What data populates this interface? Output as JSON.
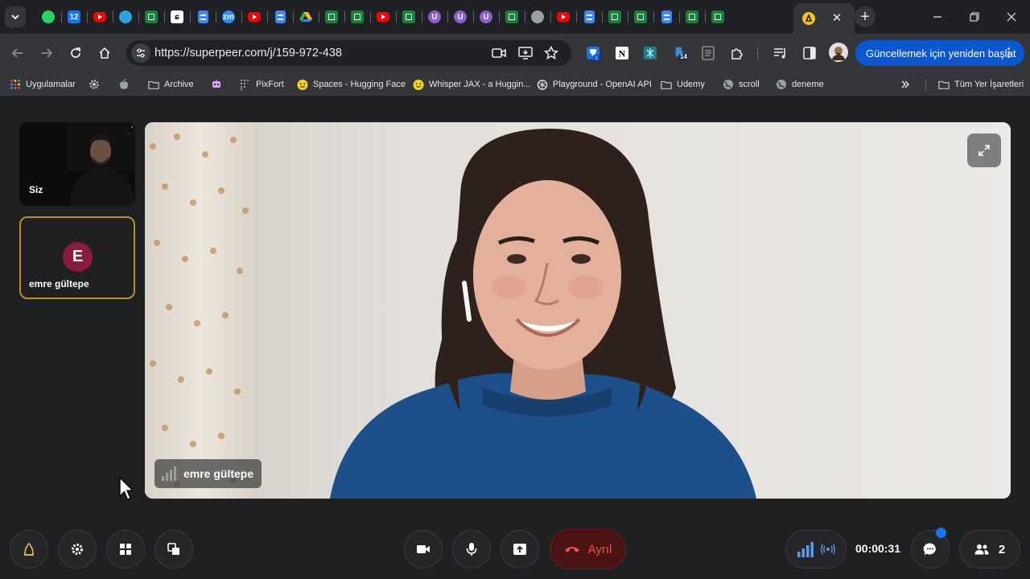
{
  "browser": {
    "tabs": [
      {
        "icon": "whatsapp-icon",
        "color": "#25d366"
      },
      {
        "icon": "calendar-icon",
        "color": "#1a73e8",
        "text": "12"
      },
      {
        "icon": "youtube-icon",
        "color": "#ff0000"
      },
      {
        "icon": "telegram-icon",
        "color": "#2aa3df"
      },
      {
        "icon": "sheets-icon",
        "color": "#188038"
      },
      {
        "icon": "c-logo-icon",
        "color": "#000000"
      },
      {
        "icon": "docs-icon",
        "color": "#4285f4"
      },
      {
        "icon": "zoom-icon",
        "color": "#2d8cff",
        "text": "zm"
      },
      {
        "icon": "youtube-icon",
        "color": "#ff0000"
      },
      {
        "icon": "docs-icon",
        "color": "#4285f4"
      },
      {
        "icon": "drive-icon",
        "color": "#fbbc04"
      },
      {
        "icon": "sheets-icon",
        "color": "#188038"
      },
      {
        "icon": "sheets-icon",
        "color": "#188038"
      },
      {
        "icon": "youtube-icon",
        "color": "#ff0000"
      },
      {
        "icon": "sheets-icon",
        "color": "#188038"
      },
      {
        "icon": "u-logo-icon",
        "color": "#8e5ec8"
      },
      {
        "icon": "u-logo-icon",
        "color": "#8e5ec8"
      },
      {
        "icon": "u-logo-icon",
        "color": "#8e5ec8"
      },
      {
        "icon": "sheets-icon",
        "color": "#188038"
      },
      {
        "icon": "globe-icon",
        "color": "#9aa0a6"
      },
      {
        "icon": "youtube-icon",
        "color": "#ff0000"
      },
      {
        "icon": "docs-icon",
        "color": "#4285f4"
      },
      {
        "icon": "sheets-icon",
        "color": "#188038"
      },
      {
        "icon": "sheets-icon",
        "color": "#188038"
      },
      {
        "icon": "docs-icon",
        "color": "#4285f4"
      },
      {
        "icon": "sheets-icon",
        "color": "#188038"
      },
      {
        "icon": "sheets-icon",
        "color": "#188038"
      }
    ],
    "active_tab_icon": "superpeer-icon",
    "url": "https://superpeer.com/j/159-972-438",
    "update_button": "Güncellemek için yeniden başlat",
    "extension_badge": "14",
    "bookmarks": {
      "apps": "Uygulamalar",
      "archive": "Archive",
      "pixfort": "PixFort",
      "spaces": "Spaces - Hugging Face",
      "whisper": "Whisper JAX - a Huggin...",
      "playground": "Playground - OpenAI API",
      "udemy": "Udemy",
      "scroll": "scroll",
      "deneme": "deneme",
      "all": "Tüm Yer İşaretleri"
    }
  },
  "meeting": {
    "self_label": "Siz",
    "remote_initial": "E",
    "remote_name": "emre gültepe",
    "speaker_name": "emre gültepe",
    "leave_label": "Ayrıl",
    "timer": "00:00:31",
    "participant_count": "2"
  },
  "colors": {
    "accent": "#0b57d0",
    "leave": "#ef5350",
    "active_border": "#b5902d",
    "avatar": "#8a1c3f"
  }
}
